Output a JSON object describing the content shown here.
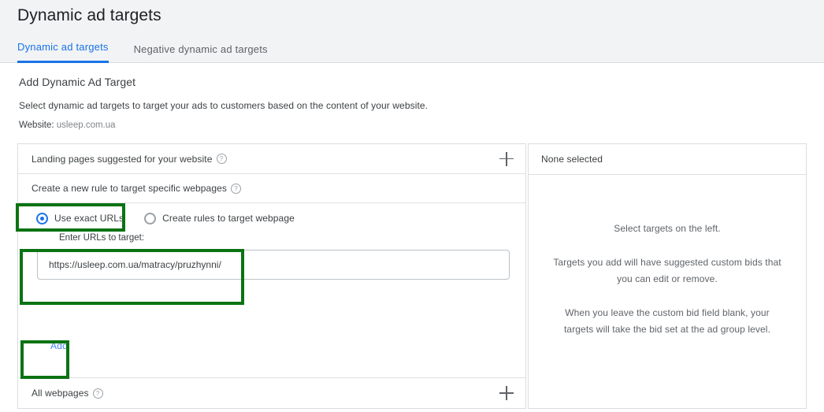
{
  "header": {
    "title": "Dynamic ad targets",
    "tabs": [
      {
        "label": "Dynamic ad targets",
        "active": true
      },
      {
        "label": "Negative dynamic ad targets",
        "active": false
      }
    ]
  },
  "section": {
    "title": "Add Dynamic Ad Target",
    "description": "Select dynamic ad targets to target your ads to customers based on the content of your website.",
    "website_label": "Website:",
    "website_value": "usleep.com.ua"
  },
  "left_panel": {
    "landing_pages_row": {
      "label": "Landing pages suggested for your website",
      "help_icon": "help-circle-icon",
      "add_icon": "plus-icon"
    },
    "new_rule_row": {
      "label": "Create a new rule to target specific webpages",
      "help_icon": "help-circle-icon"
    },
    "radios": [
      {
        "label": "Use exact URLs",
        "checked": true
      },
      {
        "label": "Create rules to target webpage",
        "checked": false
      }
    ],
    "url_caption": "Enter URLs to target:",
    "url_value": "https://usleep.com.ua/matracy/pruzhynni/",
    "url_placeholder": "",
    "add_button": "Add",
    "all_webpages_row": {
      "label": "All webpages",
      "help_icon": "help-circle-icon",
      "add_icon": "plus-icon"
    }
  },
  "right_panel": {
    "header": "None selected",
    "messages": [
      "Select targets on the left.",
      "Targets you add will have suggested custom bids that you can edit or remove.",
      "When you leave the custom bid field blank, your targets will take the bid set at the ad group level."
    ]
  },
  "annotations": {
    "highlight_color": "#0b7313",
    "boxes": [
      {
        "name": "use-exact-urls-highlight"
      },
      {
        "name": "url-input-highlight"
      },
      {
        "name": "add-button-highlight"
      }
    ]
  },
  "colors": {
    "accent_blue": "#1a73e8",
    "link_blue": "#4285f4",
    "header_bg": "#f1f3f4",
    "border": "#dadce0"
  }
}
